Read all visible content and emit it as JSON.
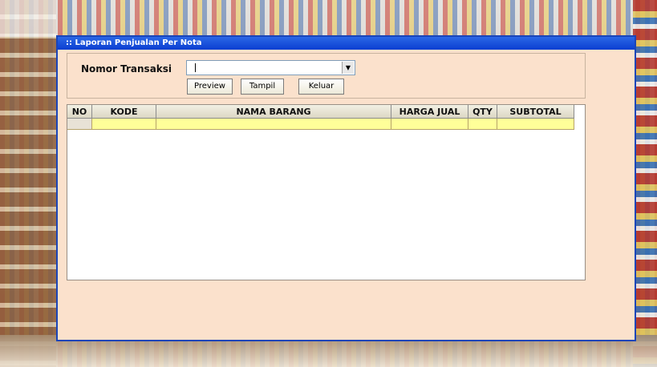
{
  "window": {
    "title": ":: Laporan Penjualan Per Nota"
  },
  "form": {
    "nomor_transaksi_label": "Nomor Transaksi",
    "nomor_transaksi_value": "",
    "buttons": {
      "preview": "Preview",
      "tampil": "Tampil",
      "keluar": "Keluar"
    }
  },
  "table": {
    "columns": [
      "NO",
      "KODE",
      "NAMA BARANG",
      "HARGA JUAL",
      "QTY",
      "SUBTOTAL"
    ],
    "rows": [
      [
        "",
        "",
        "",
        "",
        "",
        ""
      ]
    ]
  },
  "icons": {
    "dropdown": "chevron-down-icon"
  }
}
